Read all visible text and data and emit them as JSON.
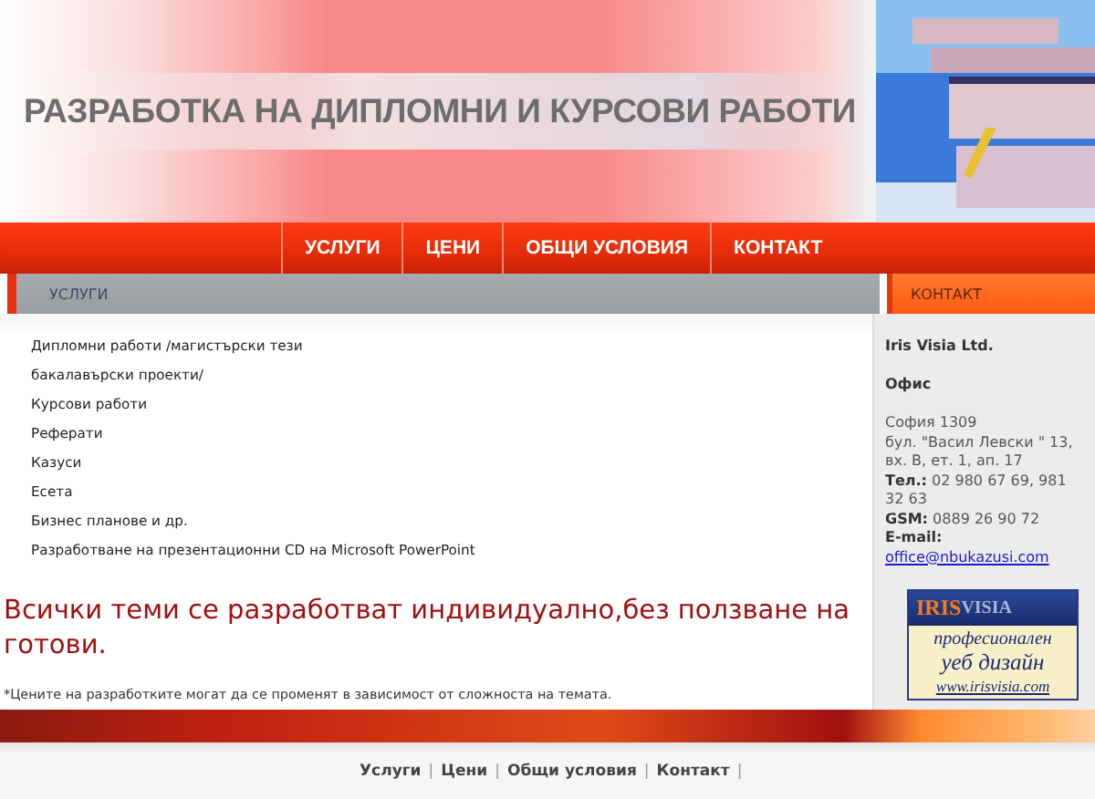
{
  "banner": {
    "title": "РАЗРАБОТКА НА ДИПЛОМНИ И КУРСОВИ РАБОТИ"
  },
  "nav": [
    {
      "label": "УСЛУГИ"
    },
    {
      "label": "ЦЕНИ"
    },
    {
      "label": "ОБЩИ УСЛОВИЯ"
    },
    {
      "label": "КОНТАКТ"
    }
  ],
  "main": {
    "heading": "УСЛУГИ",
    "services": [
      "Дипломни работи /магистърски тези",
      "бакалавърски проекти/",
      "Курсови работи",
      "Реферати",
      "Казуси",
      "Есета",
      "Бизнес планове и др.",
      "Разработване на презентационни CD на Microsoft PowerPoint"
    ],
    "notice": "Всички теми се разработват индивидуално,без ползване на готови.",
    "footnote": "*Цените на разработките могат да се променят в зависимост от сложноста на темата."
  },
  "sidebar": {
    "heading": "КОНТАКТ",
    "company": "Iris Visia Ltd.",
    "office": "Офис",
    "address": "София 1309\nбул. \"Васил Левски \" 13, вх. В, ет. 1, ап. 17\n**Тел.:** 02 980 67 69, 981 32 63\n**GSM:** 0889 26 90 72\n**E-mail:**",
    "email": "office@nbukazusi.com",
    "ad": {
      "brand_first": "IRIS",
      "brand_second": "VISIA",
      "line_1": "професионален",
      "line_2": "уеб дизайн",
      "url": "www.irisvisia.com"
    }
  },
  "footer": {
    "links": [
      "Услуги",
      "Цени",
      "Общи условия",
      "Контакт"
    ],
    "separator": "|"
  }
}
